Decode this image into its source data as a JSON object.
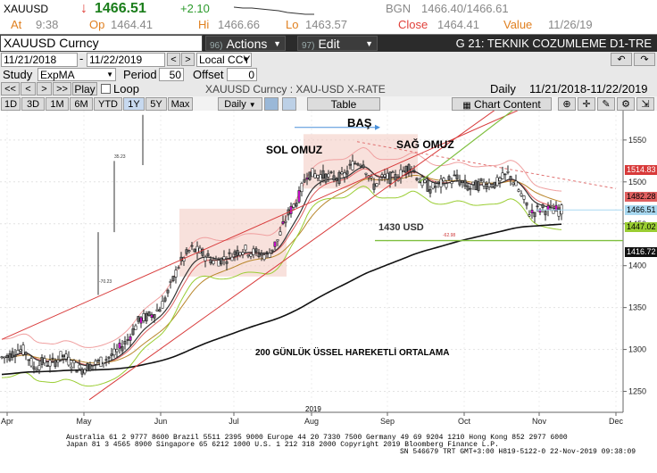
{
  "quote": {
    "ticker": "XAUUSD",
    "arrow": "↓",
    "last": "1466.51",
    "change": "+2.10",
    "bgn_label": "BGN",
    "bgn_value": "1466.40/1466.61",
    "at_label": "At",
    "at_value": "9:38",
    "op_label": "Op",
    "op_value": "1464.41",
    "hi_label": "Hi",
    "hi_value": "1466.66",
    "lo_label": "Lo",
    "lo_value": "1463.57",
    "close_label": "Close",
    "close_value": "1464.41",
    "value_label": "Value",
    "value_value": "11/26/19"
  },
  "toolbar": {
    "security": "XAUUSD  Curncy",
    "actions_num": "96)",
    "actions_label": "Actions",
    "edit_num": "97)",
    "edit_label": "Edit",
    "title": "G 21: TEKNIK COZUMLEME D1-TRE"
  },
  "range": {
    "start": "11/21/2018",
    "end": "11/22/2019",
    "currency": "Local CCY"
  },
  "study": {
    "label": "Study",
    "value": "ExpMA",
    "period_label": "Period",
    "period_value": "50",
    "offset_label": "Offset",
    "offset_value": "0"
  },
  "playback": {
    "buttons": [
      "<<",
      "<",
      ">",
      ">>"
    ],
    "play": "Play",
    "loop": "Loop",
    "description": "XAUUSD  Curncy : XAU-USD X-RATE",
    "frequency": "Daily",
    "period": "11/21/2018-11/22/2019"
  },
  "periods": {
    "items": [
      "1D",
      "3D",
      "1M",
      "6M",
      "YTD",
      "1Y",
      "5Y",
      "Max"
    ],
    "selected": "1Y",
    "interval": "Daily",
    "table": "Table",
    "chart_content": "Chart Content"
  },
  "annotations": {
    "head": "BAŞ",
    "left_shoulder": "SOL OMUZ",
    "right_shoulder": "SAĞ OMUZ",
    "support": "1430 USD",
    "ema": "200 GÜNLÜK ÜSSEL HAREKETLİ ORTALAMA",
    "small_top": "35.23",
    "small_bottom": "-70.23",
    "small_mid": "-62.98"
  },
  "price_tags": [
    {
      "value": "1514.83",
      "color": "#d83a3a"
    },
    {
      "value": "1482.28",
      "color": "#e06060"
    },
    {
      "value": "1466.51",
      "color": "#a8d8f0"
    },
    {
      "value": "1447.02",
      "color": "#9acd32"
    },
    {
      "value": "1416.72",
      "color": "#111111"
    }
  ],
  "chart_data": {
    "type": "candlestick",
    "y_ticks": [
      "1550",
      "1500",
      "1450",
      "1400",
      "1350",
      "1300",
      "1250"
    ],
    "x_ticks": [
      "Apr",
      "May",
      "Jun",
      "Jul",
      "Aug",
      "Sep",
      "Oct",
      "Nov",
      "Dec"
    ],
    "year_label": "2019",
    "ylim": [
      1225,
      1585
    ],
    "current": 1466.51
  },
  "footer": {
    "line1": "Australia 61 2 9777 8600 Brazil 5511 2395 9000 Europe 44 20 7330 7500 Germany 49 69 9204 1210 Hong Kong 852 2977 6000",
    "line2": "Japan 81 3 4565 8900      Singapore 65 6212 1000      U.S. 1 212 318 2000            Copyright 2019 Bloomberg Finance L.P.",
    "line3": "SN 546679 TRT  GMT+3:00 H819-5122-0 22-Nov-2019 09:38:09"
  },
  "colors": {
    "up": "#ffffff",
    "down": "#6b6b6b",
    "highlight": "#d40bd4",
    "ema200": "#111111",
    "channel": "#d83a3a",
    "green_line": "#7fbf3f"
  }
}
